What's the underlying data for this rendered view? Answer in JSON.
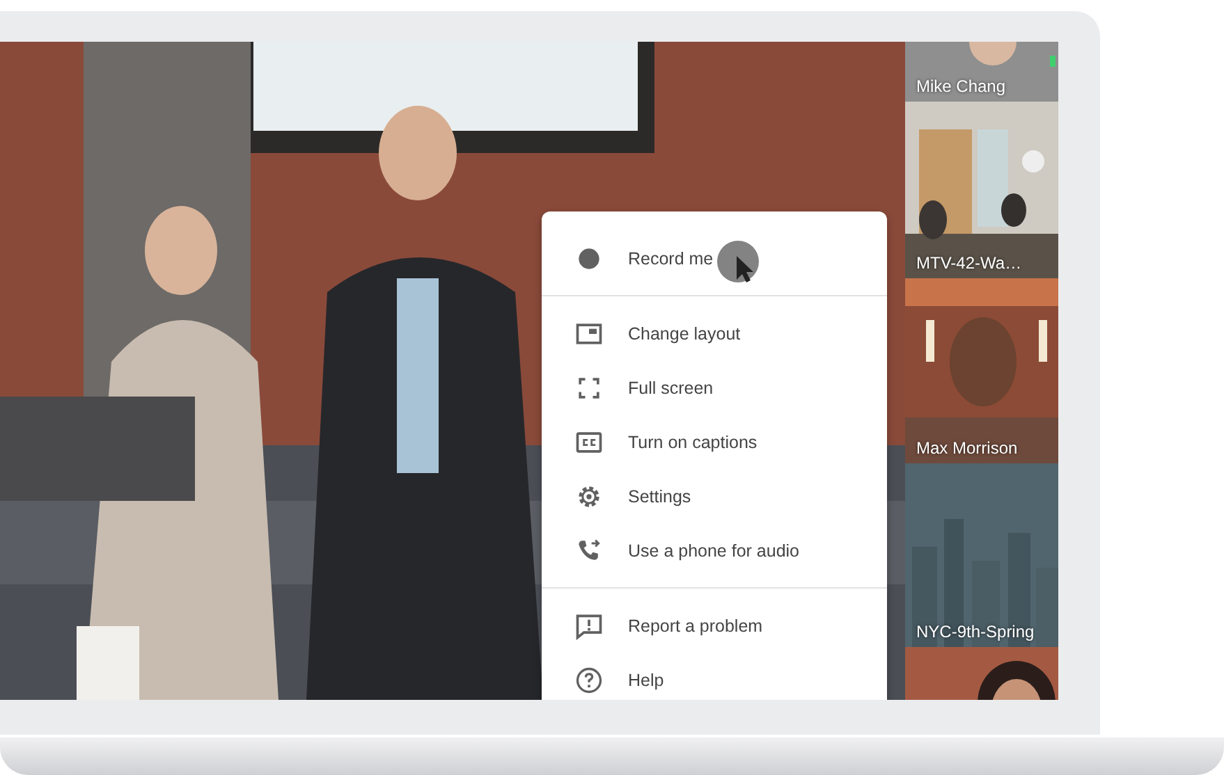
{
  "menu": {
    "sections": [
      [
        {
          "kind": "record",
          "label": "Record me"
        }
      ],
      [
        {
          "kind": "layout",
          "label": "Change layout"
        },
        {
          "kind": "fullscreen",
          "label": "Full screen"
        },
        {
          "kind": "captions",
          "label": "Turn on captions"
        },
        {
          "kind": "settings",
          "label": "Settings"
        },
        {
          "kind": "phone",
          "label": "Use a phone for audio"
        }
      ],
      [
        {
          "kind": "report",
          "label": "Report a problem"
        },
        {
          "kind": "help",
          "label": "Help"
        }
      ]
    ]
  },
  "participants": [
    {
      "kind": "avatar",
      "name": "Mike Chang"
    },
    {
      "kind": "room",
      "name": "MTV-42-Wa…"
    },
    {
      "kind": "person",
      "name": "Max Morrison"
    },
    {
      "kind": "city",
      "name": "NYC-9th-Spring"
    },
    {
      "kind": "partial"
    }
  ]
}
